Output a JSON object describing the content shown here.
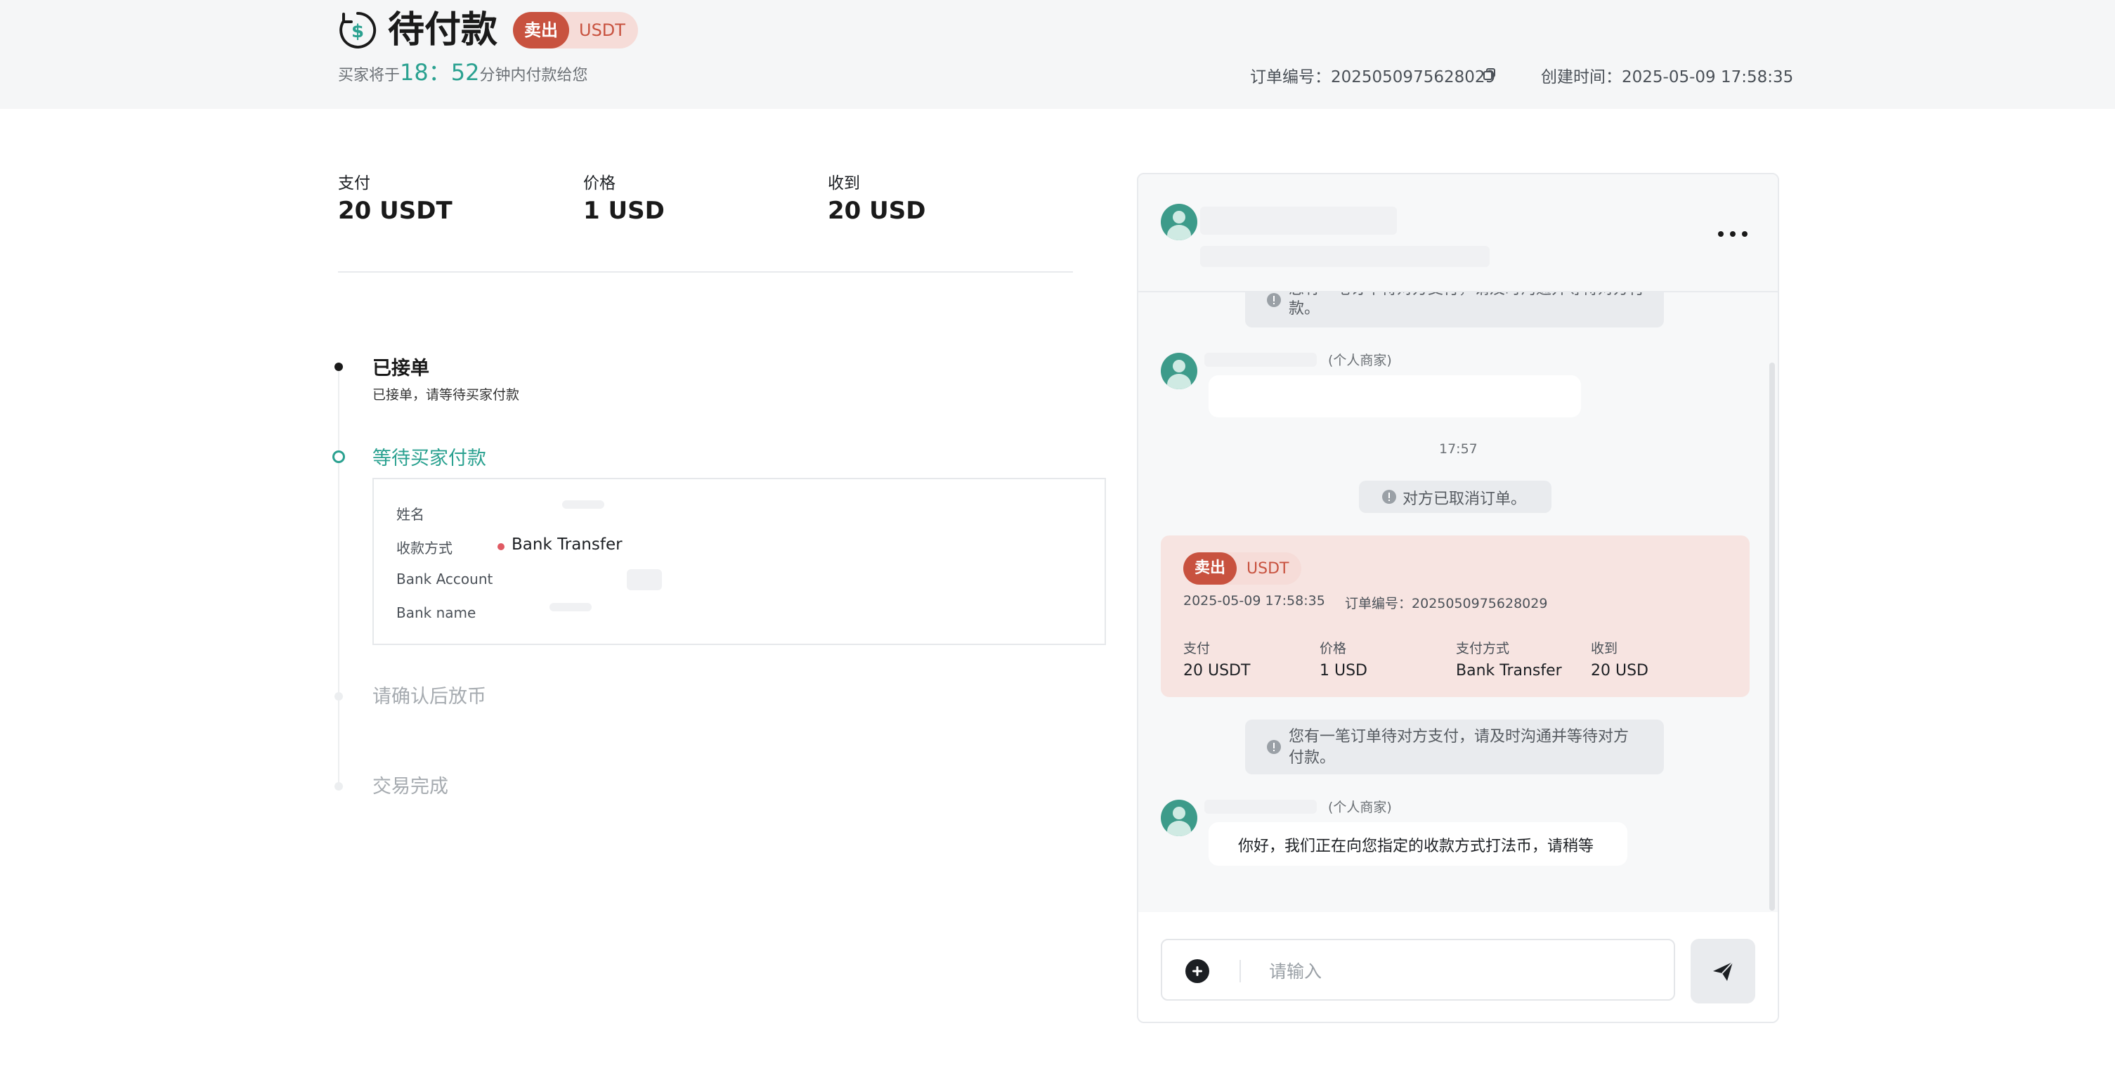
{
  "header": {
    "title": "待付款",
    "side_badge": "卖出",
    "coin_badge": "USDT",
    "countdown_prefix": "买家将于",
    "countdown_minutes": "18",
    "countdown_sep": "：",
    "countdown_seconds": "52",
    "countdown_suffix": "分钟内付款给您",
    "order_no_label": "订单编号：",
    "order_no": "2025050975628029",
    "created_label": "创建时间：",
    "created_time": "2025-05-09 17:58:35"
  },
  "summary": [
    {
      "label": "支付",
      "value": "20 USDT"
    },
    {
      "label": "价格",
      "value": "1 USD"
    },
    {
      "label": "收到",
      "value": "20 USD"
    }
  ],
  "timeline": {
    "step1_title": "已接单",
    "step1_sub": "已接单，请等待买家付款",
    "step2_title": "等待买家付款",
    "step3_title": "请确认后放币",
    "step4_title": "交易完成",
    "payment": {
      "name_label": "姓名",
      "method_label": "收款方式",
      "method_value": "Bank Transfer",
      "account_label": "Bank Account",
      "bankname_label": "Bank name"
    }
  },
  "chat": {
    "sys_msg_top": "您有一笔订单待对方支付，请及时沟通并等待对方付款。",
    "merchant_tag": "(个人商家)",
    "time": "17:57",
    "cancel_msg": "对方已取消订单。",
    "order_card": {
      "side": "卖出",
      "coin": "USDT",
      "datetime": "2025-05-09 17:58:35",
      "order_label": "订单编号：",
      "order_no": "2025050975628029",
      "pay_label": "支付",
      "pay_value": "20 USDT",
      "price_label": "价格",
      "price_value": "1 USD",
      "method_label": "支付方式",
      "method_value": "Bank Transfer",
      "receive_label": "收到",
      "receive_value": "20 USD"
    },
    "sys_msg_line1": "您有一笔订单待对方支付，请及时沟通并等待对方",
    "sys_msg_line2": "付款。",
    "merchant_message": "你好，我们正在向您指定的收款方式打法币，请稍等",
    "input_placeholder": "请输入"
  },
  "colors": {
    "accent": "#2aa190",
    "sell": "#c8523f",
    "sell_bg": "#f6dcd8",
    "card_bg": "#f7e4e1"
  }
}
